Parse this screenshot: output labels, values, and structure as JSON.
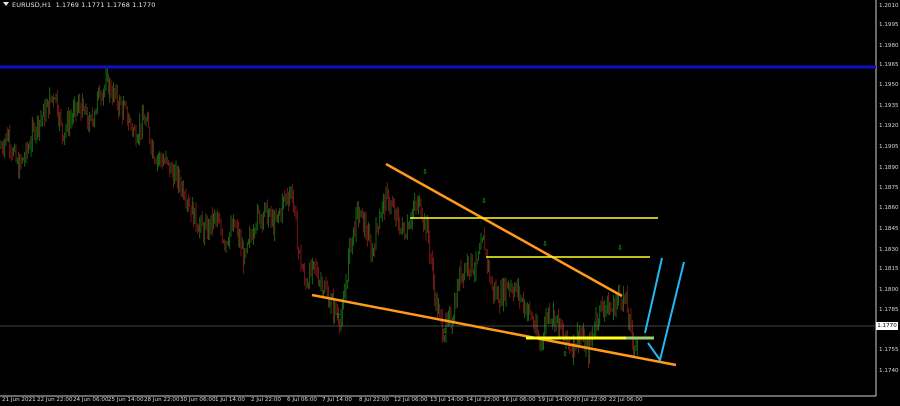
{
  "symbol_header": {
    "symbol_timeframe": "EURUSD,H1",
    "ohlc": "1.1769 1.1771 1.1768 1.1770"
  },
  "price_axis": [
    "1.2010",
    "1.1995",
    "1.1980",
    "1.1965",
    "1.1950",
    "1.1935",
    "1.1920",
    "1.1905",
    "1.1890",
    "1.1875",
    "1.1860",
    "1.1845",
    "1.1830",
    "1.1815",
    "1.1800",
    "1.1785",
    "1.1755",
    "1.1740"
  ],
  "current_price": "1.1770",
  "time_axis": [
    "21 Jun 2021",
    "22 Jun 22:00",
    "24 Jun 06:00",
    "25 Jun 14:00",
    "28 Jun 22:00",
    "30 Jun 06:00",
    "1 Jul 14:00",
    "2 Jul 22:00",
    "6 Jul 06:00",
    "7 Jul 14:00",
    "8 Jul 22:00",
    "12 Jul 06:00",
    "13 Jul 14:00",
    "14 Jul 22:00",
    "16 Jul 06:00",
    "19 Jul 14:00",
    "20 Jul 22:00",
    "22 Jul 06:00"
  ],
  "colors": {
    "background": "#000000",
    "bull_candle": "#1f8f1f",
    "bear_candle": "#a52020",
    "horizontal_level": "#1010c8",
    "trendline": "#ff9a1a",
    "resistance_line": "#ffff20",
    "forecast_arrow": "#22b8f0",
    "fractal_arrow": "#20c020",
    "axis_text": "#d8d8d8"
  },
  "chart_data": {
    "type": "candlestick",
    "y_range": [
      1.1735,
      1.2012
    ],
    "horizontal_level": 1.1962,
    "current_price": 1.177,
    "close_path": [
      [
        0,
        1.191
      ],
      [
        8,
        1.192
      ],
      [
        18,
        1.1895
      ],
      [
        26,
        1.1905
      ],
      [
        35,
        1.1925
      ],
      [
        45,
        1.1935
      ],
      [
        55,
        1.195
      ],
      [
        62,
        1.192
      ],
      [
        70,
        1.193
      ],
      [
        80,
        1.194
      ],
      [
        90,
        1.1925
      ],
      [
        100,
        1.195
      ],
      [
        108,
        1.1955
      ],
      [
        115,
        1.1945
      ],
      [
        125,
        1.1935
      ],
      [
        135,
        1.192
      ],
      [
        145,
        1.193
      ],
      [
        155,
        1.1905
      ],
      [
        165,
        1.19
      ],
      [
        175,
        1.189
      ],
      [
        185,
        1.188
      ],
      [
        195,
        1.186
      ],
      [
        205,
        1.185
      ],
      [
        215,
        1.186
      ],
      [
        225,
        1.1845
      ],
      [
        235,
        1.1855
      ],
      [
        245,
        1.183
      ],
      [
        255,
        1.186
      ],
      [
        265,
        1.1865
      ],
      [
        275,
        1.1855
      ],
      [
        285,
        1.1875
      ],
      [
        292,
        1.188
      ],
      [
        298,
        1.184
      ],
      [
        305,
        1.1815
      ],
      [
        315,
        1.1825
      ],
      [
        325,
        1.181
      ],
      [
        335,
        1.1795
      ],
      [
        342,
        1.179
      ],
      [
        350,
        1.184
      ],
      [
        358,
        1.1865
      ],
      [
        365,
        1.1855
      ],
      [
        372,
        1.1835
      ],
      [
        380,
        1.1865
      ],
      [
        388,
        1.1875
      ],
      [
        396,
        1.186
      ],
      [
        404,
        1.185
      ],
      [
        412,
        1.1865
      ],
      [
        420,
        1.187
      ],
      [
        428,
        1.185
      ],
      [
        436,
        1.18
      ],
      [
        444,
        1.178
      ],
      [
        452,
        1.179
      ],
      [
        460,
        1.182
      ],
      [
        468,
        1.183
      ],
      [
        476,
        1.1825
      ],
      [
        484,
        1.1845
      ],
      [
        492,
        1.181
      ],
      [
        500,
        1.1805
      ],
      [
        508,
        1.1815
      ],
      [
        516,
        1.181
      ],
      [
        524,
        1.18
      ],
      [
        532,
        1.179
      ],
      [
        540,
        1.177
      ],
      [
        548,
        1.1795
      ],
      [
        556,
        1.179
      ],
      [
        564,
        1.1775
      ],
      [
        572,
        1.177
      ],
      [
        580,
        1.178
      ],
      [
        588,
        1.1765
      ],
      [
        596,
        1.179
      ],
      [
        604,
        1.18
      ],
      [
        612,
        1.1795
      ],
      [
        620,
        1.1808
      ],
      [
        626,
        1.18
      ],
      [
        632,
        1.1775
      ],
      [
        638,
        1.177
      ]
    ]
  }
}
